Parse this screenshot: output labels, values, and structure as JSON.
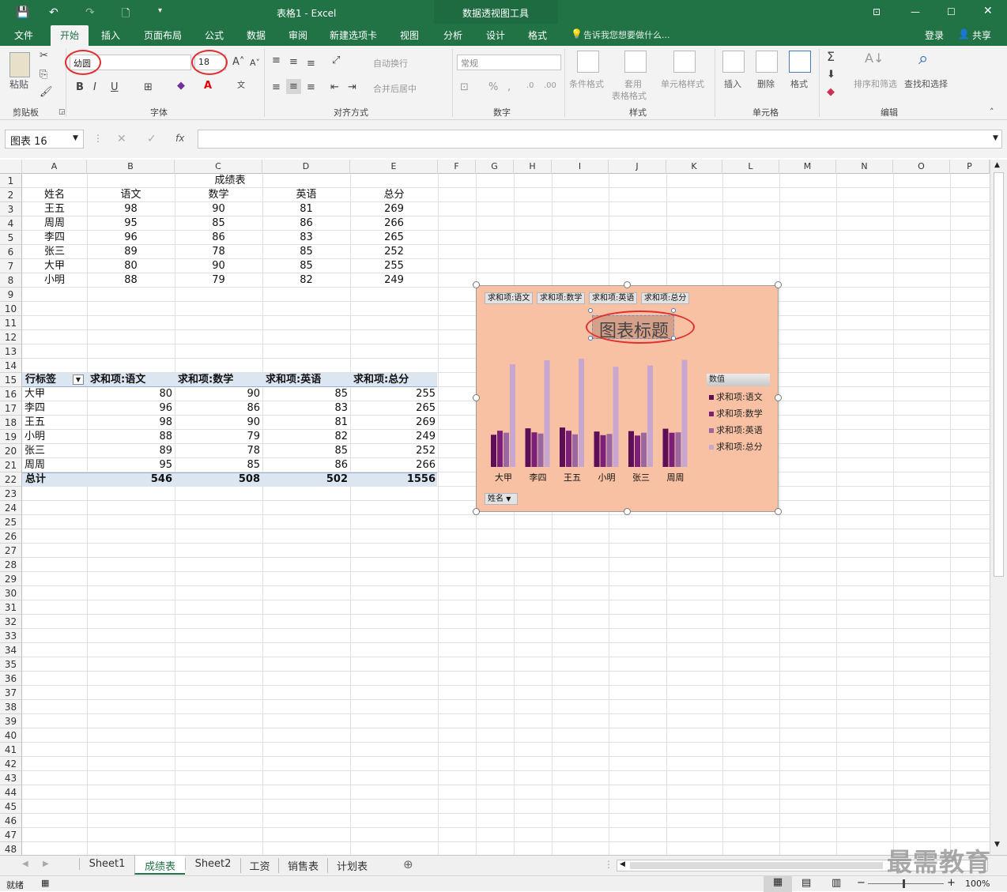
{
  "titlebar": {
    "title": "表格1 - Excel",
    "context_title": "数据透视图工具"
  },
  "tabs": [
    "文件",
    "开始",
    "插入",
    "页面布局",
    "公式",
    "数据",
    "审阅",
    "新建选项卡",
    "视图",
    "分析",
    "设计",
    "格式"
  ],
  "tell_me": "告诉我您想要做什么...",
  "login": "登录",
  "share": "共享",
  "ribbon": {
    "paste": "粘贴",
    "font_name": "幼圆",
    "font_size": "18",
    "wrap_text": "自动换行",
    "merge_center": "合并后居中",
    "number_format": "常规",
    "cond_format": "条件格式",
    "table_format_1": "套用",
    "table_format_2": "表格格式",
    "cell_styles": "单元格样式",
    "insert": "插入",
    "delete": "删除",
    "format": "格式",
    "sort_filter": "排序和筛选",
    "find_select": "查找和选择",
    "groups": {
      "clipboard": "剪贴板",
      "font": "字体",
      "alignment": "对齐方式",
      "number": "数字",
      "styles": "样式",
      "cells": "单元格",
      "editing": "编辑"
    }
  },
  "name_box": "图表 16",
  "fx_label": "fx",
  "columns": [
    "A",
    "B",
    "C",
    "D",
    "E",
    "F",
    "G",
    "H",
    "I",
    "J",
    "K",
    "L",
    "M",
    "N",
    "O",
    "P"
  ],
  "table": {
    "title": "成绩表",
    "headers": [
      "姓名",
      "语文",
      "数学",
      "英语",
      "总分"
    ],
    "rows": [
      [
        "王五",
        "98",
        "90",
        "81",
        "269"
      ],
      [
        "周周",
        "95",
        "85",
        "86",
        "266"
      ],
      [
        "李四",
        "96",
        "86",
        "83",
        "265"
      ],
      [
        "张三",
        "89",
        "78",
        "85",
        "252"
      ],
      [
        "大甲",
        "80",
        "90",
        "85",
        "255"
      ],
      [
        "小明",
        "88",
        "79",
        "82",
        "249"
      ]
    ]
  },
  "pivot": {
    "headers": [
      "行标签",
      "求和项:语文",
      "求和项:数学",
      "求和项:英语",
      "求和项:总分"
    ],
    "rows": [
      [
        "大甲",
        "80",
        "90",
        "85",
        "255"
      ],
      [
        "李四",
        "96",
        "86",
        "83",
        "265"
      ],
      [
        "王五",
        "98",
        "90",
        "81",
        "269"
      ],
      [
        "小明",
        "88",
        "79",
        "82",
        "249"
      ],
      [
        "张三",
        "89",
        "78",
        "85",
        "252"
      ],
      [
        "周周",
        "95",
        "85",
        "86",
        "266"
      ]
    ],
    "total": [
      "总计",
      "546",
      "508",
      "502",
      "1556"
    ]
  },
  "chart_data": {
    "type": "bar",
    "title": "图表标题",
    "categories": [
      "大甲",
      "李四",
      "王五",
      "小明",
      "张三",
      "周周"
    ],
    "series": [
      {
        "name": "求和项:语文",
        "values": [
          80,
          96,
          98,
          88,
          89,
          95
        ],
        "color": "#5c0e57"
      },
      {
        "name": "求和项:数学",
        "values": [
          90,
          86,
          90,
          79,
          78,
          85
        ],
        "color": "#7b1f78"
      },
      {
        "name": "求和项:英语",
        "values": [
          85,
          83,
          81,
          82,
          85,
          86
        ],
        "color": "#9b67a0"
      },
      {
        "name": "求和项:总分",
        "values": [
          255,
          265,
          269,
          249,
          252,
          266
        ],
        "color": "#c7a7d0"
      }
    ],
    "legend_title": "数值",
    "axis_button": "姓名",
    "ylim": [
      0,
      269
    ],
    "grid": false,
    "legend": "right",
    "background": "#f8c1a4"
  },
  "sheets": [
    "Sheet1",
    "成绩表",
    "Sheet2",
    "工资",
    "销售表",
    "计划表"
  ],
  "active_sheet": 1,
  "status": {
    "ready": "就绪",
    "zoom": "100%"
  },
  "watermark": "最需教育"
}
